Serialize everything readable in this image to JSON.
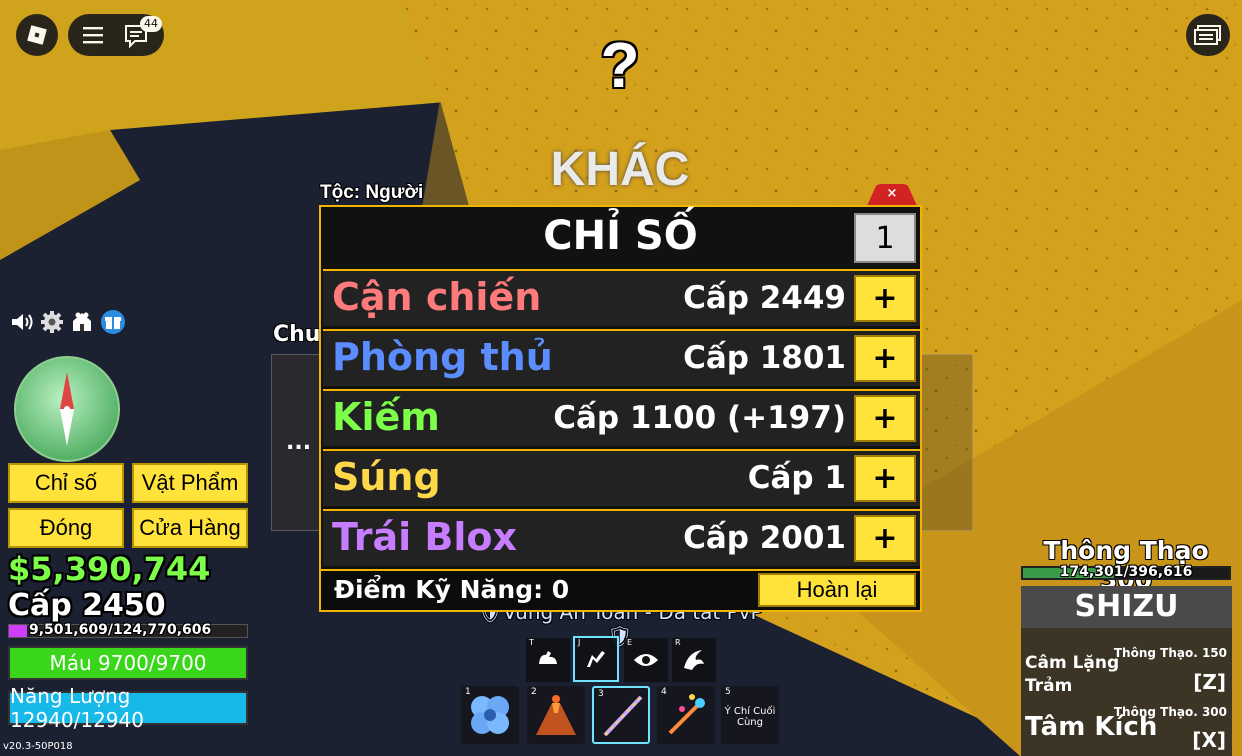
{
  "topbar": {
    "chat_badge": "44"
  },
  "center_header": {
    "question_mark": "?",
    "title": "KHÁC"
  },
  "race_label": "Tộc: Người",
  "hidden_label": "Chu",
  "hidden_dots": "...",
  "stats_panel": {
    "title": "CHỈ SỐ",
    "amount_value": "1",
    "close_label": "×",
    "rows": [
      {
        "name": "Cận chiến",
        "level": "Cấp 2449",
        "color": "#ff7a7a",
        "plus": "+"
      },
      {
        "name": "Phòng thủ",
        "level": "Cấp 1801",
        "color": "#5b8dff",
        "plus": "+"
      },
      {
        "name": "Kiếm",
        "level": "Cấp 1100 (+197)",
        "color": "#7dff4a",
        "plus": "+"
      },
      {
        "name": "Súng",
        "level": "Cấp 1",
        "color": "#ffd84a",
        "plus": "+"
      },
      {
        "name": "Trái Blox",
        "level": "Cấp 2001",
        "color": "#c77dff",
        "plus": "+"
      }
    ],
    "skill_points": "Điểm Kỹ Năng: 0",
    "reset_label": "Hoàn lại"
  },
  "left_menu": {
    "stats_button": "Chỉ số",
    "items_button": "Vật Phẩm",
    "close_button": "Đóng",
    "shop_button": "Cửa Hàng"
  },
  "player": {
    "money": "$5,390,744",
    "level": "Cấp 2450",
    "xp": "9,501,609/124,770,606",
    "xp_fraction": 0.076,
    "health": "Máu 9700/9700",
    "energy": "Năng Lượng 12940/12940"
  },
  "version": "v20.3-50P018",
  "pvp_banner": "Vùng An Toàn - Đã tắt PvP",
  "skill_keys": [
    "T",
    "J",
    "E",
    "R"
  ],
  "hotbar": [
    {
      "num": "1",
      "icon": "blue-flower-fruit-icon"
    },
    {
      "num": "2",
      "icon": "volcano-fruit-icon"
    },
    {
      "num": "3",
      "icon": "staff-icon"
    },
    {
      "num": "4",
      "icon": "jeweled-sword-icon"
    },
    {
      "num": "5",
      "label": "Ý Chí Cuối Cùng"
    }
  ],
  "right_panel": {
    "mastery_title": "Thông Thạo 300",
    "mastery_progress": "174,301/396,616",
    "mastery_fraction": 0.44,
    "weapon_name": "SHIZU",
    "skills": [
      {
        "name": "Câm Lặng Trảm",
        "req": "Thông Thạo. 150",
        "key": "[Z]"
      },
      {
        "name": "Tâm Kích",
        "req": "Thông Thạo. 300",
        "key": "[X]"
      }
    ]
  }
}
